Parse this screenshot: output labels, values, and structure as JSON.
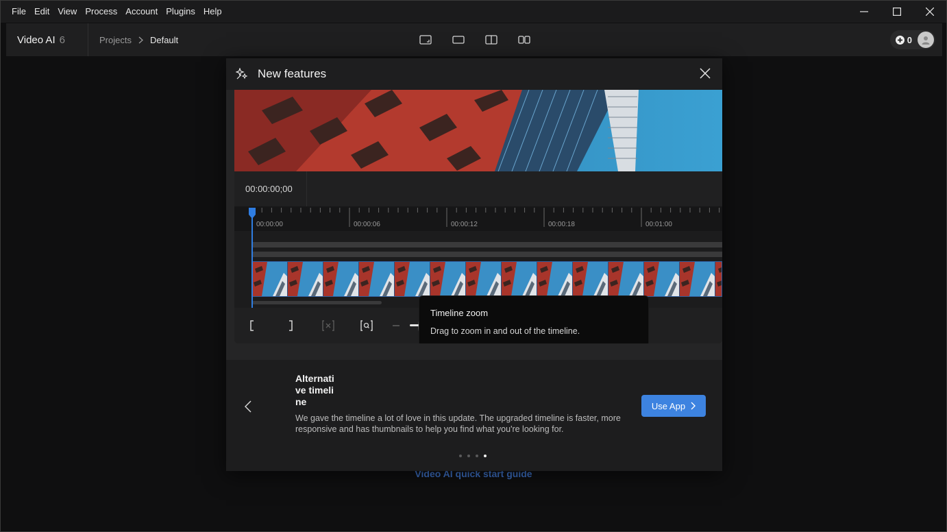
{
  "menu": [
    "File",
    "Edit",
    "View",
    "Process",
    "Account",
    "Plugins",
    "Help"
  ],
  "window_controls": {
    "minimize": "minimize-icon",
    "maximize": "maximize-icon",
    "close": "close-icon"
  },
  "header": {
    "app_name": "Video AI",
    "app_version": "6",
    "breadcrumb": {
      "projects": "Projects",
      "current": "Default"
    },
    "credits": "0"
  },
  "background": {
    "quickstart_link": "Video AI quick start guide"
  },
  "modal": {
    "title": "New features",
    "preview": {
      "timecode": "00:00:00;00",
      "ruler_labels": [
        "00:00:00",
        "00:00:06",
        "00:00:12",
        "00:00:18",
        "00:01:00"
      ],
      "zoom_level": 0.3
    },
    "tooltip": {
      "title": "Timeline zoom",
      "body": "Drag to zoom in and out of the timeline."
    },
    "feature": {
      "title": "Alternative timeline",
      "description": "We gave the timeline a lot of love in this update. The upgraded timeline is faster, more responsive and has thumbnails to help you find what you're looking for.",
      "cta": "Use App"
    },
    "pagination": {
      "total": 4,
      "current": 4
    }
  },
  "colors": {
    "accent": "#3d83e0",
    "playhead": "#2f7de1",
    "link": "#3e72c8"
  }
}
